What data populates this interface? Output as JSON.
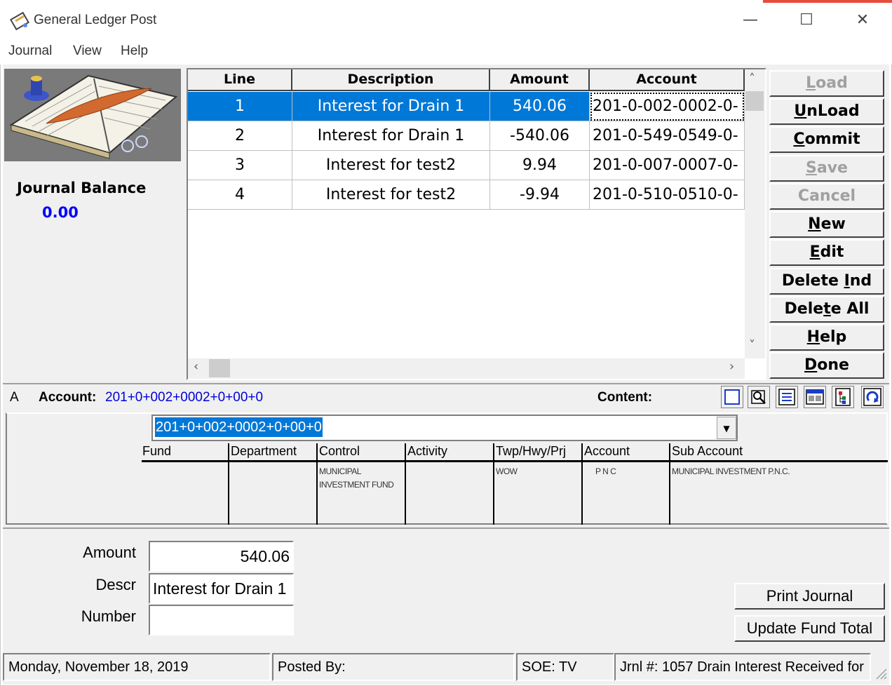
{
  "window": {
    "title": "General Ledger Post",
    "controls": {
      "minimize": "—",
      "maximize": "☐",
      "close": "✕"
    }
  },
  "menu": [
    "Journal",
    "View",
    "Help"
  ],
  "left_panel": {
    "balance_label": "Journal Balance",
    "balance_value": "0.00"
  },
  "grid": {
    "columns": [
      "Line",
      "Description",
      "Amount",
      "Account"
    ],
    "rows": [
      {
        "line": "1",
        "description": "Interest for Drain 1",
        "amount": "540.06",
        "account": "201-0-002-0002-0-",
        "selected": true
      },
      {
        "line": "2",
        "description": "Interest for Drain 1",
        "amount": "-540.06",
        "account": "201-0-549-0549-0-",
        "selected": false
      },
      {
        "line": "3",
        "description": "Interest for test2",
        "amount": "9.94",
        "account": "201-0-007-0007-0-",
        "selected": false
      },
      {
        "line": "4",
        "description": "Interest for test2",
        "amount": "-9.94",
        "account": "201-0-510-0510-0-",
        "selected": false
      }
    ]
  },
  "buttons": {
    "load": {
      "pre": "",
      "u": "L",
      "post": "oad",
      "enabled": false
    },
    "unload": {
      "pre": "",
      "u": "U",
      "post": "nLoad",
      "enabled": true
    },
    "commit": {
      "pre": "",
      "u": "C",
      "post": "ommit",
      "enabled": true
    },
    "save": {
      "pre": "",
      "u": "S",
      "post": "ave",
      "enabled": false
    },
    "cancel": {
      "pre": "Cancel",
      "u": "",
      "post": "",
      "enabled": false
    },
    "new": {
      "pre": "",
      "u": "N",
      "post": "ew",
      "enabled": true
    },
    "edit": {
      "pre": "",
      "u": "E",
      "post": "dit",
      "enabled": true
    },
    "delete_ind": {
      "pre": "Delete ",
      "u": "I",
      "post": "nd",
      "enabled": true
    },
    "delete_all": {
      "pre": "Dele",
      "u": "t",
      "post": "e All",
      "enabled": true
    },
    "help": {
      "pre": "",
      "u": "H",
      "post": "elp",
      "enabled": true
    },
    "done": {
      "pre": "",
      "u": "D",
      "post": "one",
      "enabled": true
    }
  },
  "account": {
    "prefix": "A",
    "label": "Account:",
    "value": "201+0+002+0002+0+00+0",
    "content_label": "Content:",
    "combo_value": "201+0+002+0002+0+00+0",
    "segments": [
      {
        "name": "Fund",
        "desc": ""
      },
      {
        "name": "Department",
        "desc": ""
      },
      {
        "name": "Control",
        "desc": "MUNICIPAL INVESTMENT FUND"
      },
      {
        "name": "Activity",
        "desc": ""
      },
      {
        "name": "Twp/Hwy/Prj",
        "desc": "WOW"
      },
      {
        "name": "Account",
        "desc": "P N C"
      },
      {
        "name": "Sub Account",
        "desc": "MUNICIPAL INVESTMENT P.N.C."
      }
    ]
  },
  "form": {
    "amount_label": "Amount",
    "amount_value": "540.06",
    "descr_label": "Descr",
    "descr_value": "Interest for Drain 1",
    "number_label": "Number",
    "number_value": "",
    "print_journal": "Print Journal",
    "update_fund_total": "Update Fund Total"
  },
  "status": {
    "date": "Monday, November 18, 2019",
    "posted_by": "Posted By:",
    "soe": "SOE: TV",
    "jrnl": "Jrnl #: 1057 Drain Interest Received for"
  },
  "colors": {
    "selection": "#0078d7",
    "balance": "#0000ff",
    "account_value": "#0000dd"
  }
}
